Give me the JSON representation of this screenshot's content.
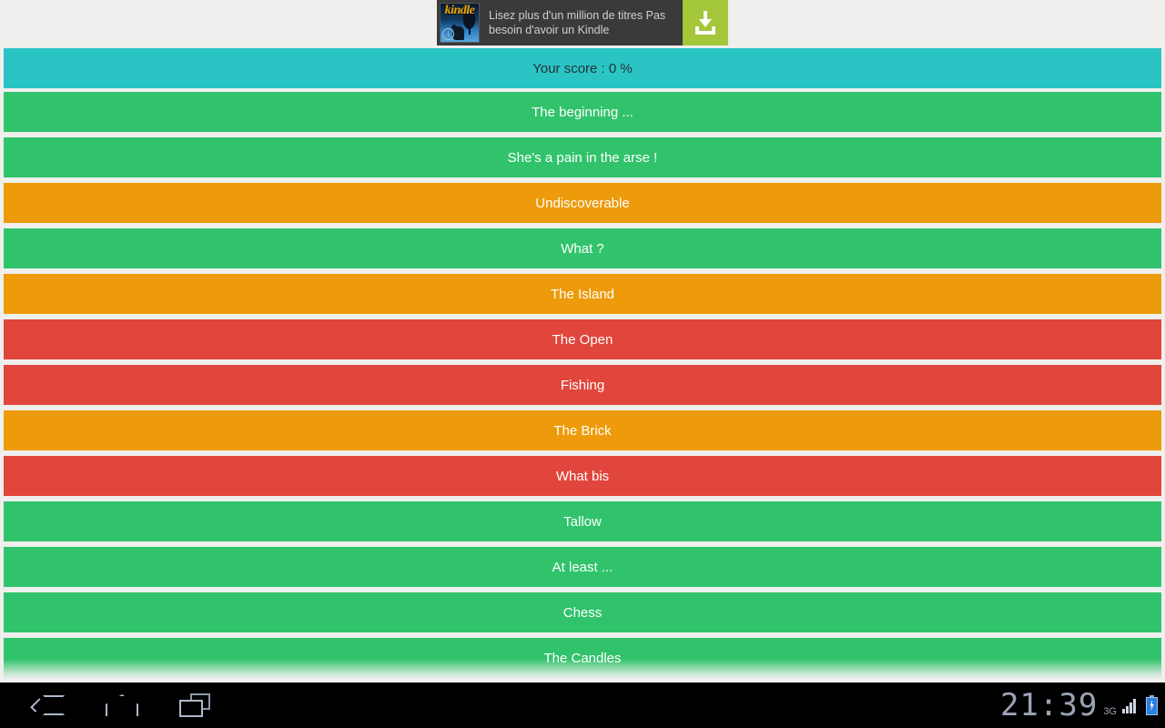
{
  "ad": {
    "icon_name": "kindle-app-icon",
    "brand": "kindle",
    "text": "Lisez plus d'un million de titres Pas besoin d'avoir un Kindle",
    "info_badge": "i",
    "cta_icon": "download-icon",
    "cta_color": "#a4c639"
  },
  "score": {
    "label": "Your score : 0 %",
    "background": "#2bc4c4",
    "text_color": "#263238"
  },
  "colors": {
    "green": "#31c36c",
    "orange": "#ed9b0b",
    "red": "#e0463c",
    "page_background": "#efefed"
  },
  "list": {
    "items": [
      {
        "label": "The beginning ...",
        "status": "green"
      },
      {
        "label": "She's a pain in the arse !",
        "status": "green"
      },
      {
        "label": "Undiscoverable",
        "status": "orange"
      },
      {
        "label": "What ?",
        "status": "green"
      },
      {
        "label": "The Island",
        "status": "orange"
      },
      {
        "label": "The Open",
        "status": "red"
      },
      {
        "label": "Fishing",
        "status": "red"
      },
      {
        "label": "The Brick",
        "status": "orange"
      },
      {
        "label": "What bis",
        "status": "red"
      },
      {
        "label": "Tallow",
        "status": "green"
      },
      {
        "label": "At least ...",
        "status": "green"
      },
      {
        "label": "Chess",
        "status": "green"
      },
      {
        "label": "The Candles",
        "status": "green"
      }
    ]
  },
  "navbar": {
    "back_label": "Back",
    "home_label": "Home",
    "recents_label": "Recent apps",
    "clock": "21:39",
    "network": "3G",
    "signal_icon": "signal-bars-icon",
    "battery_icon": "battery-charging-icon"
  }
}
